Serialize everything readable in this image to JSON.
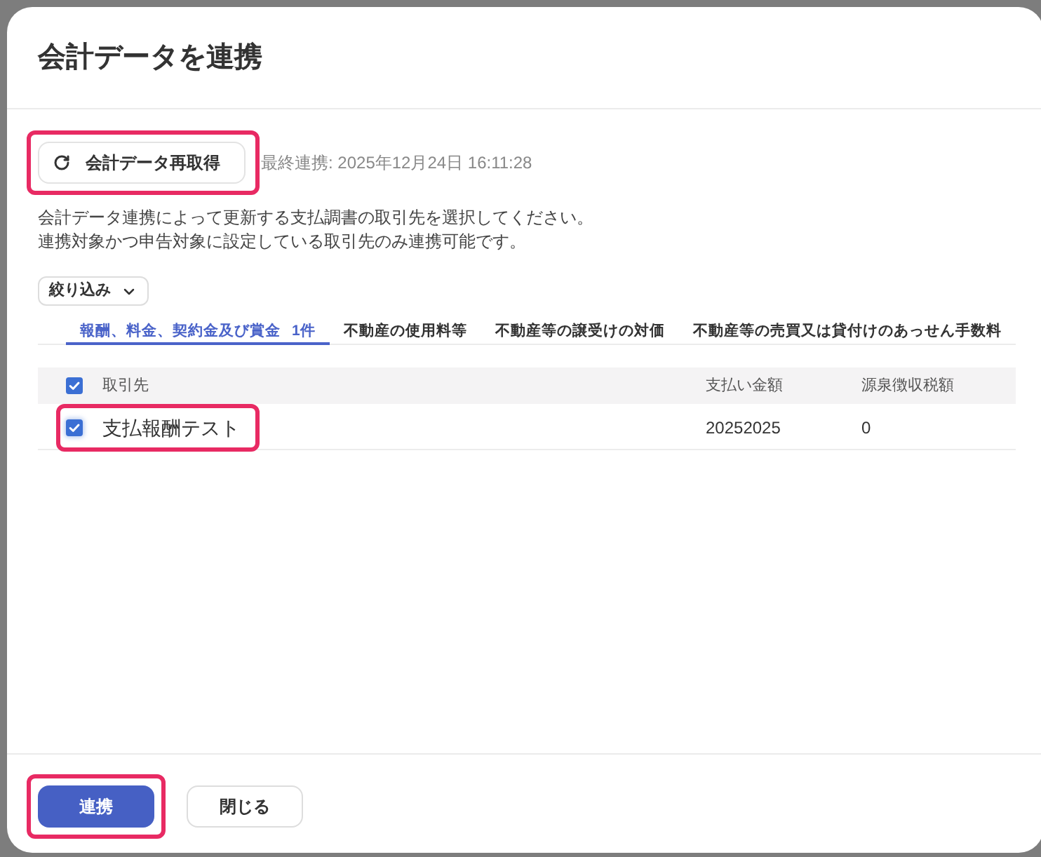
{
  "dialog": {
    "title": "会計データを連携"
  },
  "sync": {
    "button": "会計データ再取得",
    "last_synced": "最終連携: 2025年12月24日 16:11:28",
    "highlighted": true
  },
  "description": [
    "会計データ連携によって更新する支払調書の取引先を選択してください。",
    "連携対象かつ申告対象に設定している取引先のみ連携可能です。"
  ],
  "filter": {
    "label": "絞り込み"
  },
  "tabs": [
    {
      "label": "報酬、料金、契約金及び賞金",
      "count": "1件",
      "selected": true
    },
    {
      "label": "不動産の使用料等",
      "selected": false
    },
    {
      "label": "不動産等の譲受けの対価",
      "selected": false
    },
    {
      "label": "不動産等の売買又は貸付けのあっせん手数料",
      "selected": false
    }
  ],
  "table": {
    "header_checked": true,
    "columns": [
      "取引先",
      "支払い金額",
      "源泉徴収税額"
    ],
    "rows": [
      {
        "name": "支払報酬テスト",
        "amount": "20252025",
        "withholding": "0",
        "checked": true,
        "highlighted": true
      }
    ]
  },
  "footer": {
    "buttons": [
      {
        "label": "連携",
        "kind": "primary",
        "highlighted": true
      },
      {
        "label": "閉じる",
        "kind": "secondary",
        "highlighted": false
      }
    ]
  }
}
